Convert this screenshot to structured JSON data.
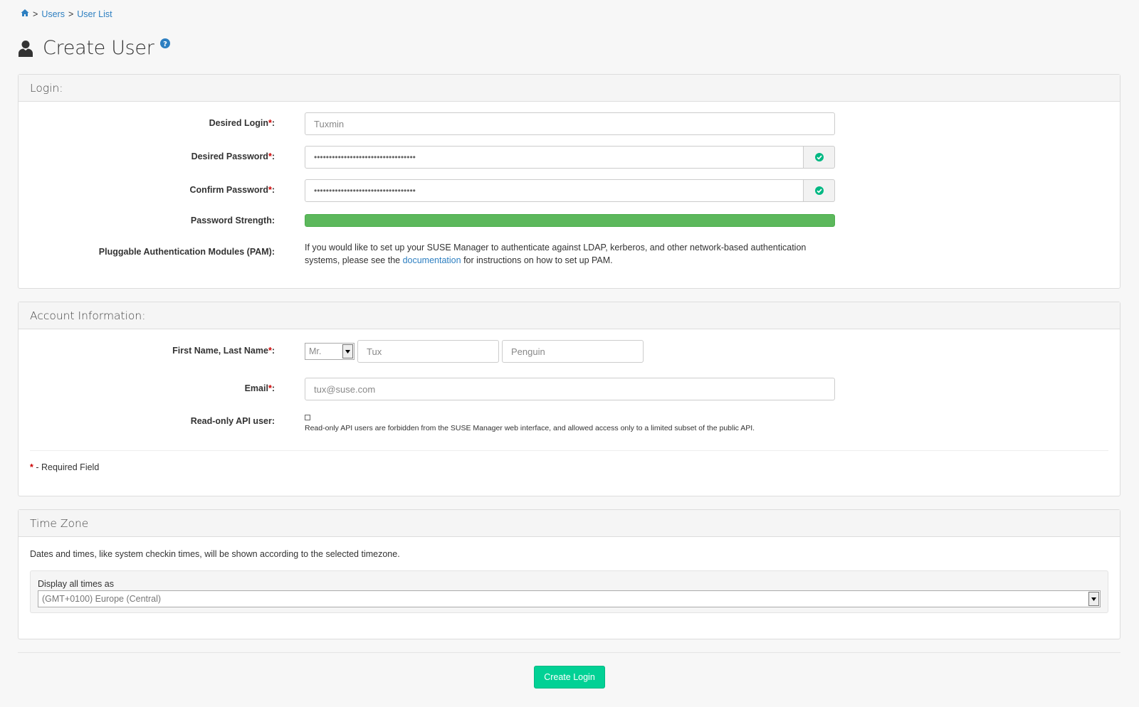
{
  "breadcrumb": {
    "home_icon": "home-icon",
    "sep1": ">",
    "users": "Users",
    "sep2": ">",
    "user_list": "User List"
  },
  "page": {
    "title": "Create User",
    "user_icon": "user-icon",
    "help_icon": "question-circle-icon"
  },
  "login_panel": {
    "heading": "Login:",
    "desired_login": {
      "label": "Desired Login",
      "required": "*",
      "colon": ":",
      "placeholder": "Tuxmin"
    },
    "desired_password": {
      "label": "Desired Password",
      "required": "*",
      "colon": ":",
      "value": "••••••••••••••••••••••••••••••••••"
    },
    "confirm_password": {
      "label": "Confirm Password",
      "required": "*",
      "colon": ":",
      "value": "••••••••••••••••••••••••••••••••••"
    },
    "password_strength": {
      "label": "Password Strength:",
      "value_percent": 100,
      "color": "#5cb85c"
    },
    "pam": {
      "label": "Pluggable Authentication Modules (PAM):",
      "text_before": "If you would like to set up your SUSE Manager to authenticate against LDAP, kerberos, and other network-based authentication systems, please see the ",
      "link": "documentation",
      "text_after": " for instructions on how to set up PAM."
    }
  },
  "account_panel": {
    "heading": "Account Information:",
    "name": {
      "label": "First Name, Last Name",
      "required": "*",
      "colon": ":",
      "prefix": "Mr.",
      "first_placeholder": "Tux",
      "last_placeholder": "Penguin"
    },
    "email": {
      "label": "Email",
      "required": "*",
      "colon": ":",
      "placeholder": "tux@suse.com"
    },
    "readonly_api": {
      "label": "Read-only API user:",
      "checked": false,
      "help": "Read-only API users are forbidden from the SUSE Manager web interface, and allowed access only to a limited subset of the public API."
    },
    "required_note": {
      "star": "*",
      "text": " - Required Field"
    }
  },
  "timezone_panel": {
    "heading": "Time Zone",
    "description": "Dates and times, like system checkin times, will be shown according to the selected timezone.",
    "select_label": "Display all times as",
    "selected": "(GMT+0100) Europe (Central)"
  },
  "actions": {
    "create_label": "Create Login",
    "accent": "#02d195"
  }
}
